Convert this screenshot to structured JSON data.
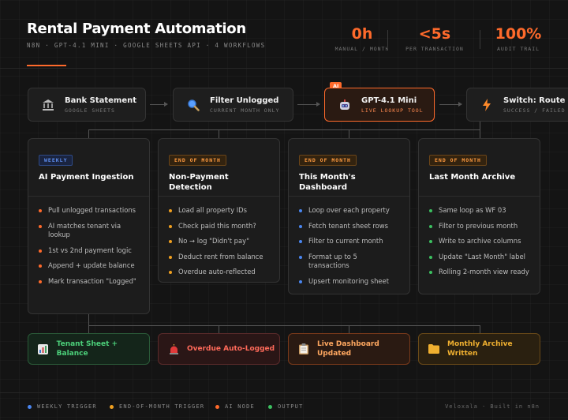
{
  "header": {
    "title": "Rental Payment Automation",
    "subtitle": "N8N · GPT-4.1 MINI · GOOGLE SHEETS API · 4 WORKFLOWS",
    "stats": [
      {
        "value": "0h",
        "label": "MANUAL / MONTH"
      },
      {
        "value": "<5s",
        "label": "PER TRANSACTION"
      },
      {
        "value": "100%",
        "label": "AUDIT TRAIL"
      }
    ],
    "accent": "#ff6a2b"
  },
  "flow": [
    {
      "title": "Bank Statement",
      "sub": "GOOGLE SHEETS",
      "icon": "bank-icon"
    },
    {
      "title": "Filter Unlogged",
      "sub": "CURRENT MONTH ONLY",
      "icon": "magnifier-icon"
    },
    {
      "title": "GPT-4.1 Mini",
      "sub": "LIVE LOOKUP TOOL",
      "icon": "robot-icon",
      "tag": "AI"
    },
    {
      "title": "Switch: Route",
      "sub": "SUCCESS / FAILED",
      "icon": "lightning-icon"
    }
  ],
  "cards": [
    {
      "badge": "WEEKLY",
      "title": "AI Payment Ingestion",
      "dot": "#ff6a2b",
      "items": [
        "Pull unlogged transactions",
        "AI matches tenant via lookup",
        "1st vs 2nd payment logic",
        "Append + update balance",
        "Mark transaction \"Logged\""
      ]
    },
    {
      "badge": "END OF MONTH",
      "title": "Non-Payment Detection",
      "dot": "#f0a020",
      "items": [
        "Load all property IDs",
        "Check paid this month?",
        "No → log \"Didn't pay\"",
        "Deduct rent from balance",
        "Overdue auto-reflected"
      ]
    },
    {
      "badge": "END OF MONTH",
      "title": "This Month's Dashboard",
      "dot": "#4a86f0",
      "items": [
        "Loop over each property",
        "Fetch tenant sheet rows",
        "Filter to current month",
        "Format up to 5 transactions",
        "Upsert monitoring sheet"
      ]
    },
    {
      "badge": "END OF MONTH",
      "title": "Last Month Archive",
      "dot": "#3cc060",
      "items": [
        "Same loop as WF 03",
        "Filter to previous month",
        "Write to archive columns",
        "Update \"Last Month\" label",
        "Rolling 2-month view ready"
      ]
    }
  ],
  "outputs": [
    {
      "label": "Tenant Sheet + Balance",
      "icon": "bar-chart-icon",
      "color": "#4cd07a"
    },
    {
      "label": "Overdue Auto-Logged",
      "icon": "siren-icon",
      "color": "#ff6a5a"
    },
    {
      "label": "Live Dashboard Updated",
      "icon": "clipboard-icon",
      "color": "#ffa860"
    },
    {
      "label": "Monthly Archive Written",
      "icon": "folder-icon",
      "color": "#f0b030"
    }
  ],
  "legend": [
    {
      "label": "WEEKLY TRIGGER",
      "color": "#4a86f0"
    },
    {
      "label": "END-OF-MONTH TRIGGER",
      "color": "#f0a020"
    },
    {
      "label": "AI NODE",
      "color": "#ff6a2b"
    },
    {
      "label": "OUTPUT",
      "color": "#3cc060"
    }
  ],
  "credit": "Veloxala · Built in n8n"
}
